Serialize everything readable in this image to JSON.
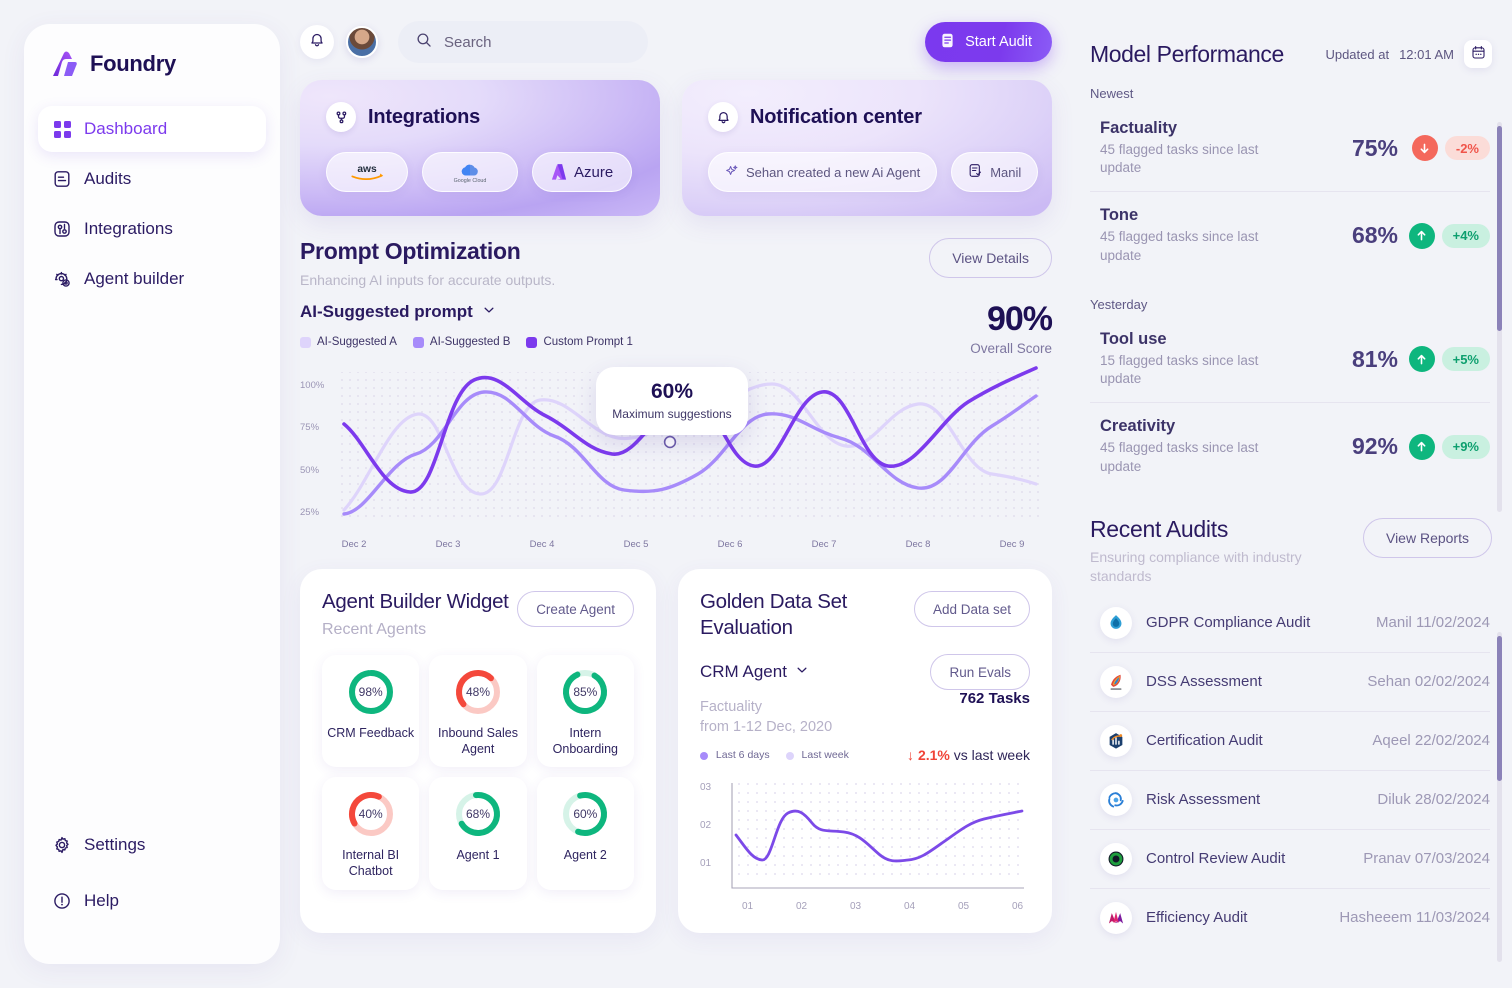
{
  "brand": {
    "name": "Foundry",
    "logo_icon": "foundry-logo-icon"
  },
  "sidebar": {
    "items": [
      {
        "label": "Dashboard",
        "icon": "grid-icon",
        "active": true
      },
      {
        "label": "Audits",
        "icon": "document-icon",
        "active": false
      },
      {
        "label": "Integrations",
        "icon": "integrations-icon",
        "active": false
      },
      {
        "label": "Agent builder",
        "icon": "gear-robot-icon",
        "active": false
      }
    ],
    "bottom_items": [
      {
        "label": "Settings",
        "icon": "gear-icon"
      },
      {
        "label": "Help",
        "icon": "info-circle-icon"
      }
    ]
  },
  "topbar": {
    "bell_icon": "bell-icon",
    "avatar": "user-avatar",
    "search_placeholder": "Search",
    "search_value": "",
    "search_icon": "search-icon",
    "start_audit_label": "Start Audit",
    "start_audit_icon": "document-list-icon"
  },
  "integrations_card": {
    "title": "Integrations",
    "icon": "git-branch-icon",
    "items": [
      {
        "label": "aws",
        "icon": "aws-logo-icon"
      },
      {
        "label": "Google Cloud",
        "icon": "google-cloud-logo-icon"
      },
      {
        "label": "Azure",
        "icon": "azure-logo-icon"
      }
    ]
  },
  "notification_card": {
    "title": "Notification center",
    "icon": "bell-icon",
    "items": [
      {
        "label": "Sehan created a new Ai Agent",
        "icon": "sparkle-icon"
      },
      {
        "label": "Manil",
        "icon": "document-check-icon"
      }
    ]
  },
  "prompt_optimization": {
    "title": "Prompt Optimization",
    "subtitle": "Enhancing AI inputs for accurate outputs.",
    "view_details_label": "View Details",
    "select_label": "AI-Suggested prompt",
    "select_icon": "chevron-down-icon",
    "overall_score": "90%",
    "overall_score_label": "Overall Score",
    "tooltip": {
      "value": "60%",
      "label": "Maximum suggestions"
    }
  },
  "chart_data": [
    {
      "id": "prompt-optimization-chart",
      "type": "line",
      "title": "Prompt Optimization",
      "xlabel": "",
      "ylabel": "",
      "x": [
        "Dec 2",
        "Dec 3",
        "Dec 4",
        "Dec 5",
        "Dec 6",
        "Dec 7",
        "Dec 8",
        "Dec 9"
      ],
      "ytick_labels": [
        "25%",
        "50%",
        "75%",
        "100%"
      ],
      "ylim": [
        20,
        105
      ],
      "grid": "dotted",
      "legend_position": "top-left",
      "series": [
        {
          "name": "AI-Suggested A",
          "color": "#ded4fb",
          "values": [
            22,
            88,
            62,
            91,
            78,
            95,
            66,
            86,
            48
          ]
        },
        {
          "name": "AI-Suggested B",
          "color": "#a78bfa",
          "values": [
            22,
            50,
            90,
            70,
            36,
            40,
            78,
            72,
            33,
            78
          ]
        },
        {
          "name": "Custom Prompt 1",
          "color": "#7c3aed",
          "values": [
            70,
            38,
            103,
            64,
            67,
            91,
            56,
            92,
            53,
            96
          ]
        }
      ],
      "annotation": {
        "value": "60%",
        "label": "Maximum suggestions",
        "x_near": "Dec 5"
      }
    },
    {
      "id": "golden-data-set-chart",
      "type": "line",
      "title": "Golden Data Set Evaluation",
      "x": [
        "01",
        "02",
        "03",
        "04",
        "05",
        "06"
      ],
      "ytick_labels": [
        "01",
        "02",
        "03"
      ],
      "ylim": [
        0,
        3
      ],
      "grid": "dotted",
      "series": [
        {
          "name": "Last 6 days",
          "color": "#7c4ae8",
          "values": [
            1.45,
            2.38,
            1.78,
            0.95,
            1.85,
            2.2
          ]
        }
      ]
    },
    {
      "id": "agent-builder-donuts",
      "type": "pie",
      "title": "Recent Agents",
      "categories": [
        "CRM Feedback",
        "Inbound Sales Agent",
        "Intern Onboarding",
        "Internal BI Chatbot",
        "Agent 1",
        "Agent 2"
      ],
      "values": [
        98,
        48,
        85,
        40,
        68,
        60
      ]
    }
  ],
  "agent_builder": {
    "title": "Agent Builder Widget",
    "subtitle": "Recent Agents",
    "create_label": "Create Agent",
    "agents": [
      {
        "name": "CRM Feedback",
        "value": "98%",
        "pct": 98,
        "color": "#0eb67e",
        "track": "#d6f3e8"
      },
      {
        "name": "Inbound Sales Agent",
        "value": "48%",
        "pct": 48,
        "color": "#f4483b",
        "track": "#fbc9c4"
      },
      {
        "name": "Intern Onboarding",
        "value": "85%",
        "pct": 85,
        "color": "#0eb67e",
        "track": "#d6f3e8"
      },
      {
        "name": "Internal BI Chatbot",
        "value": "40%",
        "pct": 40,
        "color": "#f4483b",
        "track": "#fbc9c4"
      },
      {
        "name": "Agent 1",
        "value": "68%",
        "pct": 68,
        "color": "#0eb67e",
        "track": "#d6f3e8"
      },
      {
        "name": "Agent 2",
        "value": "60%",
        "pct": 60,
        "color": "#0eb67e",
        "track": "#d6f3e8"
      }
    ]
  },
  "golden_data_set": {
    "title": "Golden Data Set Evaluation",
    "add_label": "Add Data set",
    "run_label": "Run Evals",
    "select_label": "CRM Agent",
    "select_icon": "chevron-down-icon",
    "meta_line1": "Factuality",
    "meta_line2": "from 1-12 Dec, 2020",
    "tasks": "762 Tasks",
    "delta_arrow": "arrow-down-icon",
    "delta_value": "2.1%",
    "delta_suffix": "vs last week",
    "legend": [
      {
        "label": "Last 6 days",
        "color": "#a78bfa"
      },
      {
        "label": "Last week",
        "color": "#ddd4fb"
      }
    ]
  },
  "model_performance": {
    "title": "Model Performance",
    "updated_label": "Updated at",
    "updated_time": "12:01 AM",
    "calendar_icon": "calendar-icon",
    "groups": [
      {
        "label": "Newest",
        "rows": [
          {
            "name": "Factuality",
            "desc": "45 flagged tasks since last update",
            "value": "75%",
            "change": "-2%",
            "direction": "down",
            "arrow_icon": "arrow-down-icon",
            "arrow_bg": "#f4685c",
            "badge_bg": "#fbdcd8",
            "badge_fg": "#f0544a"
          },
          {
            "name": "Tone",
            "desc": "45 flagged tasks since last update",
            "value": "68%",
            "change": "+4%",
            "direction": "up",
            "arrow_icon": "arrow-up-icon",
            "arrow_bg": "#0eb67e",
            "badge_bg": "#c9f0e0",
            "badge_fg": "#0d9f6e"
          }
        ]
      },
      {
        "label": "Yesterday",
        "rows": [
          {
            "name": "Tool use",
            "desc": "15 flagged tasks since last update",
            "value": "81%",
            "change": "+5%",
            "direction": "up",
            "arrow_icon": "arrow-up-icon",
            "arrow_bg": "#0eb67e",
            "badge_bg": "#c9f0e0",
            "badge_fg": "#0d9f6e"
          },
          {
            "name": "Creativity",
            "desc": "45 flagged tasks since last update",
            "value": "92%",
            "change": "+9%",
            "direction": "up",
            "arrow_icon": "arrow-up-icon",
            "arrow_bg": "#0eb67e",
            "badge_bg": "#c9f0e0",
            "badge_fg": "#0d9f6e"
          }
        ]
      }
    ]
  },
  "recent_audits": {
    "title": "Recent Audits",
    "subtitle": "Ensuring compliance with industry standards",
    "view_reports_label": "View Reports",
    "rows": [
      {
        "name": "GDPR Compliance Audit",
        "meta": "Manil 11/02/2024",
        "icon": "droplet-logo-icon",
        "color": "#2e9fd6"
      },
      {
        "name": "DSS Assessment",
        "meta": "Sehan 02/02/2024",
        "icon": "feather-logo-icon",
        "color": "#e04a3c"
      },
      {
        "name": "Certification Audit",
        "meta": "Aqeel 22/02/2024",
        "icon": "chart-logo-icon",
        "color": "#f08a26"
      },
      {
        "name": "Risk Assessment",
        "meta": "Diluk 28/02/2024",
        "icon": "swirl-logo-icon",
        "color": "#2a7fd6"
      },
      {
        "name": "Control Review Audit",
        "meta": "Pranav 07/03/2024",
        "icon": "ring-logo-icon",
        "color": "#1f9e3e"
      },
      {
        "name": "Efficiency Audit",
        "meta": "Hasheeem 11/03/2024",
        "icon": "mountain-logo-icon",
        "color": "#c01a6a"
      }
    ]
  },
  "theme": {
    "accent": "#7c3aed",
    "bg": "#f2f3f8",
    "text_dark": "#2b1b63",
    "up": "#0eb67e",
    "down": "#f04438"
  }
}
